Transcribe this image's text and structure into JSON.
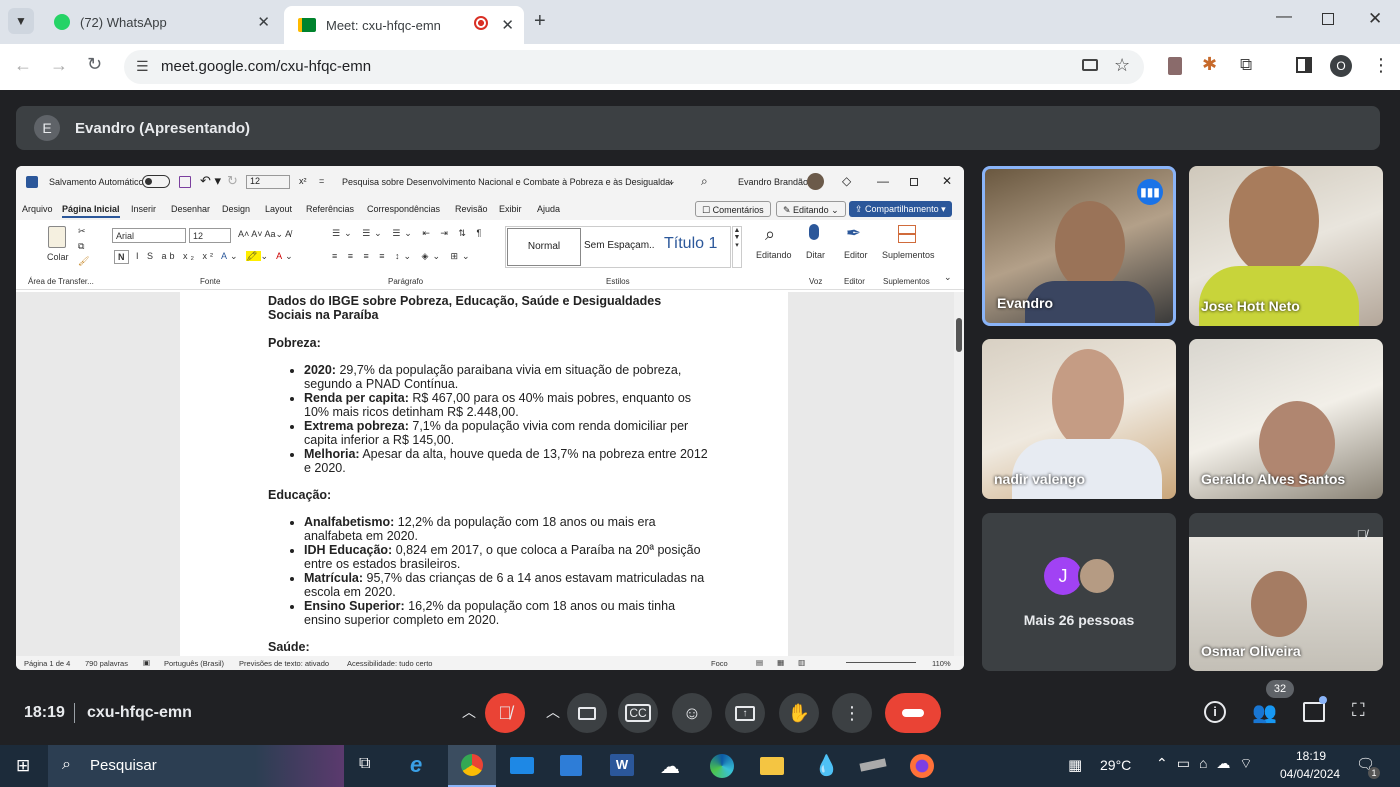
{
  "browser": {
    "tabs": [
      {
        "label": "(72) WhatsApp"
      },
      {
        "label": "Meet: cxu-hfqc-emn"
      }
    ],
    "url": "meet.google.com/cxu-hfqc-emn",
    "profile_initial": "O"
  },
  "meet": {
    "presenter_initial": "E",
    "presenter_label": "Evandro (Apresentando)",
    "time": "18:19",
    "meeting_code": "cxu-hfqc-emn",
    "participant_count": "32",
    "participants": [
      {
        "name": "Evandro"
      },
      {
        "name": "Jose Hott Neto"
      },
      {
        "name": "nadir valengo"
      },
      {
        "name": "Geraldo Alves Santos"
      },
      {
        "name": "Mais 26 pessoas",
        "avatar_initial": "J"
      },
      {
        "name": "Osmar Oliveira"
      }
    ]
  },
  "word": {
    "autosave": "Salvamento Automático",
    "font_size_top": "12",
    "doc_title": "Pesquisa sobre Desenvolvimento Nacional e Combate à Pobreza e às Desigualdades Re...",
    "user": "Evandro Brandão",
    "menu": [
      "Arquivo",
      "Página Inicial",
      "Inserir",
      "Desenhar",
      "Design",
      "Layout",
      "Referências",
      "Correspondências",
      "Revisão",
      "Exibir",
      "Ajuda"
    ],
    "comments_btn": "Comentários",
    "editing_btn": "Editando",
    "share_btn": "Compartilhamento",
    "paste_label": "Colar",
    "font_name": "Arial",
    "font_size": "12",
    "styles": [
      "Normal",
      "Sem Espaçam...",
      "Título 1"
    ],
    "editing_group": "Editando",
    "dictate": "Ditar",
    "editor": "Editor",
    "addins": "Suplementos",
    "groups": [
      "Área de Transfer...",
      "Fonte",
      "Parágrafo",
      "Estilos",
      "Voz",
      "Editor",
      "Suplementos"
    ],
    "status": {
      "page": "Página 1 de 4",
      "words": "790 palavras",
      "lang": "Português (Brasil)",
      "predict": "Previsões de texto: ativado",
      "access": "Acessibilidade: tudo certo",
      "focus": "Foco",
      "zoom": "110%"
    }
  },
  "document": {
    "heading": "Dados do IBGE sobre Pobreza, Educação, Saúde e Desigualdades Sociais na Paraíba",
    "sections": [
      {
        "title": "Pobreza:",
        "items": [
          {
            "bold": "2020:",
            "text": " 29,7% da população paraibana vivia em situação de pobreza, segundo a PNAD Contínua."
          },
          {
            "bold": "Renda per capita:",
            "text": " R$ 467,00 para os 40% mais pobres, enquanto os 10% mais ricos detinham R$ 2.448,00."
          },
          {
            "bold": "Extrema pobreza:",
            "text": " 7,1% da população vivia com renda domiciliar per capita inferior a R$ 145,00."
          },
          {
            "bold": "Melhoria:",
            "text": " Apesar da alta, houve queda de 13,7% na pobreza entre 2012 e 2020."
          }
        ]
      },
      {
        "title": "Educação:",
        "items": [
          {
            "bold": "Analfabetismo:",
            "text": " 12,2% da população com 18 anos ou mais era analfabeta em 2020."
          },
          {
            "bold": "IDH Educação:",
            "text": " 0,824 em 2017, o que coloca a Paraíba na 20ª posição entre os estados brasileiros."
          },
          {
            "bold": "Matrícula:",
            "text": " 95,7% das crianças de 6 a 14 anos estavam matriculadas na escola em 2020."
          },
          {
            "bold": "Ensino Superior:",
            "text": " 16,2% da população com 18 anos ou mais tinha ensino superior completo em 2020."
          }
        ]
      }
    ],
    "next_title": "Saúde:"
  },
  "taskbar": {
    "search": "Pesquisar",
    "temp": "29°C",
    "time": "18:19",
    "date": "04/04/2024",
    "notif": "1"
  },
  "colors": {
    "accent_blue": "#1a73e8",
    "end_call": "#ea4335",
    "word_blue": "#2b579a"
  }
}
